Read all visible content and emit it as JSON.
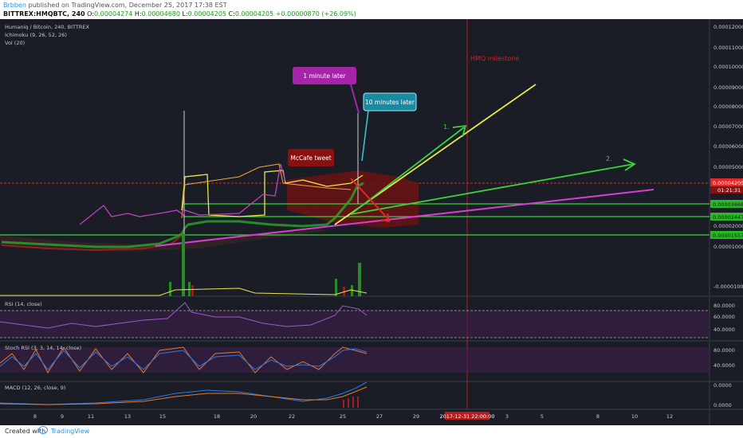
{
  "header": {
    "author": "Brbben",
    "published_text": "published on TradingView.com, December 25, 2017 17:38 EST",
    "symbol": "BITTREX:HMQBTC, 240",
    "open_label": "O:",
    "open": "0.00004274",
    "high_label": "H:",
    "high": "0.00004680",
    "low_label": "L:",
    "low": "0.00004205",
    "close_label": "C:",
    "close": "0.00004205",
    "change": "+0.00000870 (+26.09%)"
  },
  "legend": {
    "title": "Humaniq / Bitcoin, 240, BITTREX",
    "ichimoku": "Ichimoku (9, 26, 52, 26)",
    "vol": "Vol (20)",
    "rsi": "RSI (14, close)",
    "stoch": "Stoch RSI (3, 3, 14, 14, close)",
    "macd": "MACD (12, 26, close, 9)"
  },
  "price_axis": [
    "0.00012000",
    "0.00011000",
    "0.00010000",
    "0.00009000",
    "0.00008000",
    "0.00007000",
    "0.00006000",
    "0.00005000",
    "0.00002000",
    "0.00001000",
    "-0.00001000"
  ],
  "price_tags": {
    "current": "0.00004205",
    "countdown": "01:21:31",
    "g1": "0.00003668",
    "g2": "0.00002447",
    "g3": "0.00001557"
  },
  "rsi_axis": [
    "80.0000",
    "60.0000",
    "40.0000"
  ],
  "stoch_axis": [
    "80.0000",
    "40.0000"
  ],
  "macd_axis": [
    "0.0000",
    "0.0000"
  ],
  "time_axis": [
    "8",
    "9",
    "11",
    "13",
    "15",
    "18",
    "20",
    "22",
    "25",
    "27",
    "29",
    "3",
    "5",
    "8",
    "10",
    "12"
  ],
  "time_highlight": "2017-12-31 22:00:00",
  "annotations": {
    "milestone": "HMQ milestone",
    "one_minute": "1 minute later",
    "ten_minutes": "10 minutes later",
    "mccafe": "McCafe tweet",
    "arrow1": "1.",
    "arrow2": "2."
  },
  "footer": {
    "created_with": "Created with",
    "brand": "TradingView"
  },
  "colors": {
    "bg": "#1a1d26",
    "green": "#3ad33a",
    "yellow": "#e8e84a",
    "magenta": "#d43fd4",
    "red_dashed": "#e0292b",
    "milestone_red": "#c0191b",
    "purple_band": "#3c1f4a",
    "brand_blue": "#2196f3"
  }
}
